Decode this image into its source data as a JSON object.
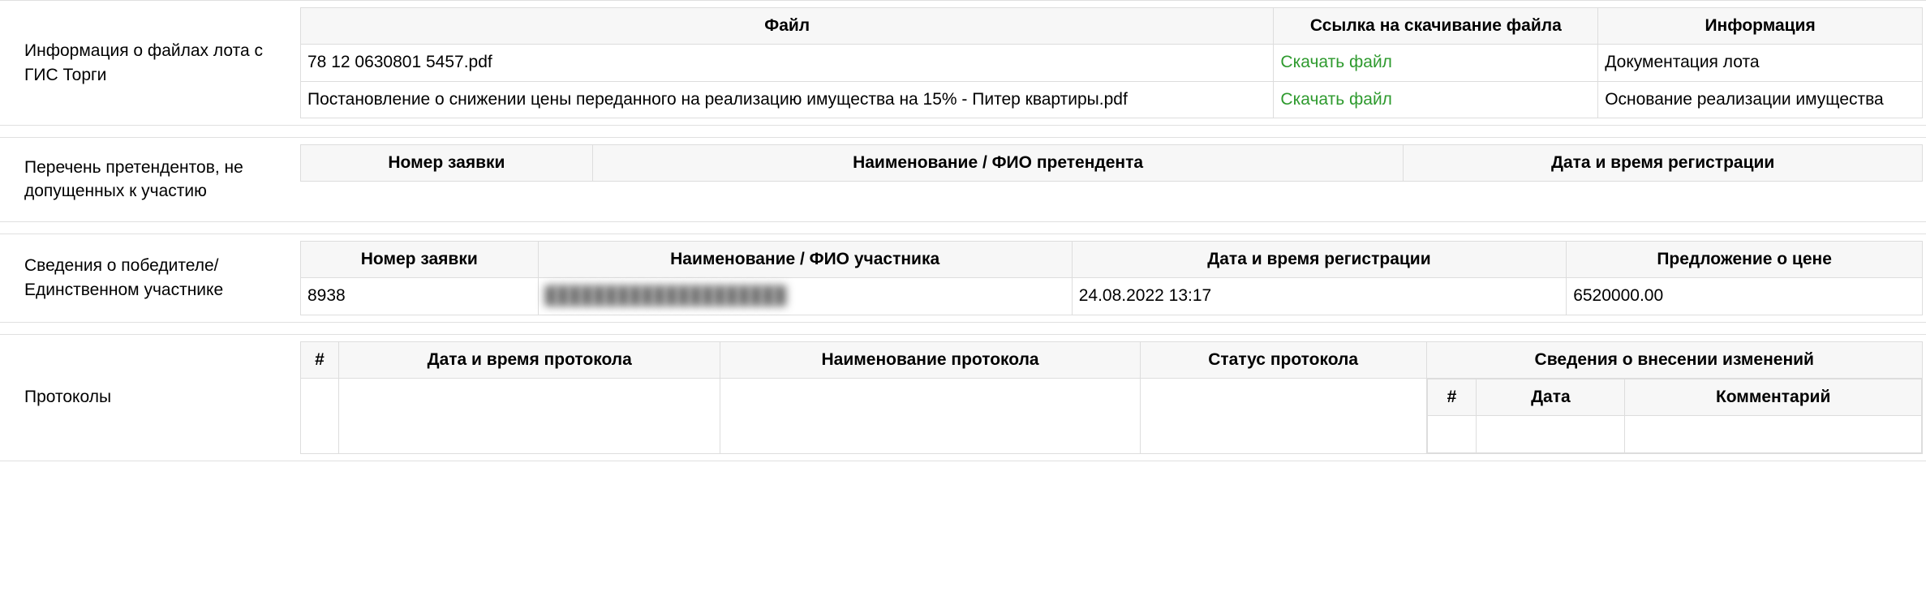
{
  "sections": {
    "files": {
      "label": "Информация о файлах лота с ГИС Торги",
      "headers": {
        "file": "Файл",
        "download": "Ссылка на скачивание файла",
        "info": "Информация"
      },
      "rows": [
        {
          "file": "78 12 0630801 5457.pdf",
          "download": "Скачать файл",
          "info": "Документация лота"
        },
        {
          "file": "Постановление о снижении цены переданного на реализацию имущества на 15% - Питер квартиры.pdf",
          "download": "Скачать файл",
          "info": "Основание реализации имущества"
        }
      ]
    },
    "rejected": {
      "label": "Перечень претендентов, не допущенных к участию",
      "headers": {
        "app_no": "Номер заявки",
        "name": "Наименование / ФИО претендента",
        "reg_date": "Дата и время регистрации"
      }
    },
    "winner": {
      "label": "Сведения о победителе/ Единственном участнике",
      "headers": {
        "app_no": "Номер заявки",
        "name": "Наименование / ФИО участника",
        "reg_date": "Дата и время регистрации",
        "price": "Предложение о цене"
      },
      "row": {
        "app_no": "8938",
        "name": "████████████████████",
        "reg_date": "24.08.2022 13:17",
        "price": "6520000.00"
      }
    },
    "protocols": {
      "label": "Протоколы",
      "headers": {
        "num": "#",
        "datetime": "Дата и время протокола",
        "name": "Наименование протокола",
        "status": "Статус протокола",
        "changes": "Сведения о внесении изменений",
        "ch_num": "#",
        "ch_date": "Дата",
        "ch_comment": "Комментарий"
      }
    }
  }
}
